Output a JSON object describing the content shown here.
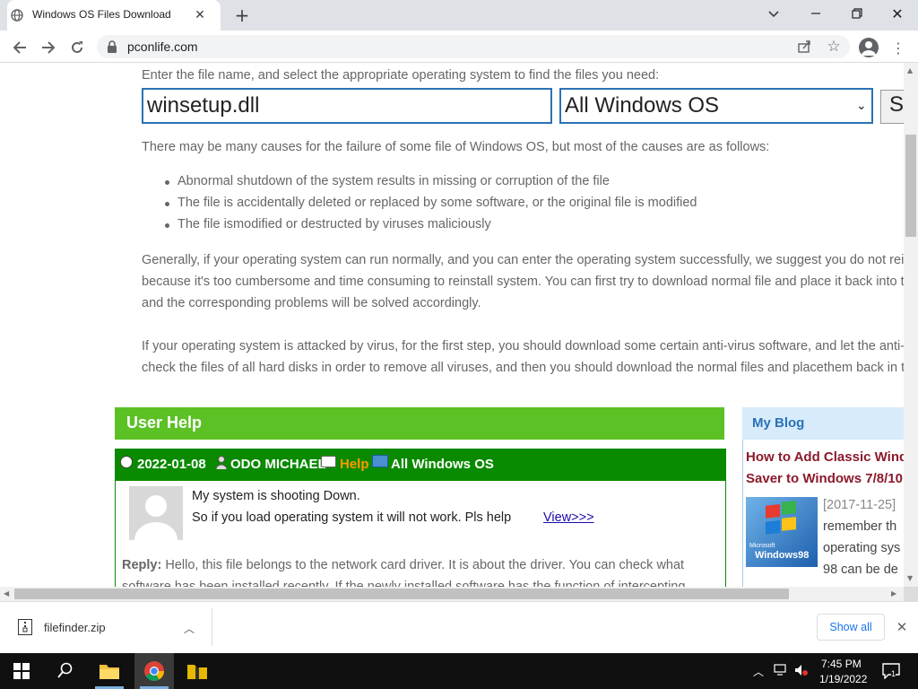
{
  "browser": {
    "tab_title": "Windows OS Files Download",
    "new_tab": "+",
    "url": "pconlife.com",
    "colors": {
      "tabstrip": "#dee1e6",
      "accent": "#1a73e8"
    }
  },
  "page": {
    "intro": "Enter the file name, and select the appropriate operating system to find the files you need:",
    "search_value": "winsetup.dll",
    "os_selected": "All Windows OS",
    "search_button": "S",
    "causes_intro": "There may be many causes for the failure of some file of Windows OS, but most of the causes are as follows:",
    "causes": [
      "Abnormal shutdown of the system results in missing or corruption of the file",
      "The file is accidentally deleted or replaced by some software, or the original file is modified",
      "The file ismodified or destructed by viruses maliciously"
    ],
    "para1": [
      "Generally, if your operating system can run normally, and you can enter the operating system successfully, we suggest you do not rein",
      "because it's too cumbersome and time consuming to reinstall system. You can first try to download normal file and place it back into t",
      "and the corresponding problems will be solved accordingly."
    ],
    "para2": [
      "If your operating system is attacked by virus, for the first step, you should download some certain anti-virus software, and let the anti-",
      "check the files of all hard disks in order to remove all viruses, and then you should download the normal files and placethem back in t"
    ]
  },
  "user_help": {
    "title": "User Help",
    "post": {
      "date": "2022-01-08",
      "author": "ODO MICHAEL",
      "category": "Help",
      "os": "All Windows OS",
      "question_line1": "My system is shooting Down.",
      "question_line2": "So if you load operating system it will not work. Pls help",
      "view_link": "View>>>",
      "reply_label": "Reply:",
      "reply_line1": " Hello, this file belongs to the network card driver. It is about the driver. You can check what",
      "reply_line2": "software has been installed recently. If the newly installed software has the function of intercepting"
    },
    "colors": {
      "header": "#5cc125",
      "post_header": "#0a8a00",
      "category": "#ff9900"
    }
  },
  "blog": {
    "title": "My Blog",
    "link_line1": "How to Add Classic Windo",
    "link_line2": "Saver to Windows 7/8/10",
    "date": "[2017-11-25]",
    "excerpt": [
      "remember th",
      "operating sys",
      "98 can be de"
    ],
    "thumb_label": "Windows98",
    "thumb_brand": "Microsoft"
  },
  "download": {
    "file_name": "filefinder.zip",
    "show_all": "Show all"
  },
  "taskbar": {
    "time": "7:45 PM",
    "date": "1/19/2022",
    "notification_count": "1"
  }
}
